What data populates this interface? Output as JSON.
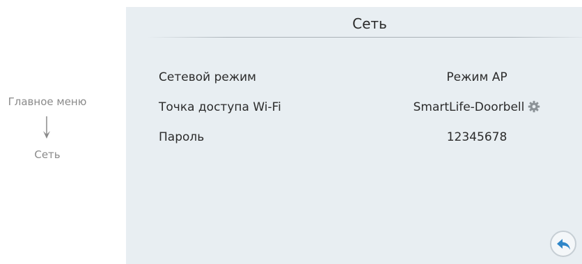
{
  "breadcrumb": {
    "parent": "Главное меню",
    "current": "Сеть"
  },
  "page": {
    "title": "Сеть"
  },
  "settings": {
    "rows": [
      {
        "label": "Сетевой режим",
        "value": "Режим AP"
      },
      {
        "label": "Точка доступа Wi-Fi",
        "value": "SmartLife-Doorbell",
        "icon": "gear-icon"
      },
      {
        "label": "Пароль",
        "value": "12345678"
      }
    ]
  },
  "back_button": {
    "icon": "back-arrow-icon"
  },
  "colors": {
    "panel_bg": "#e8eef2",
    "text": "#2b2b2b",
    "muted_text": "#8a8a8a",
    "accent": "#2f86c8",
    "icon_gray": "#8c9398"
  }
}
